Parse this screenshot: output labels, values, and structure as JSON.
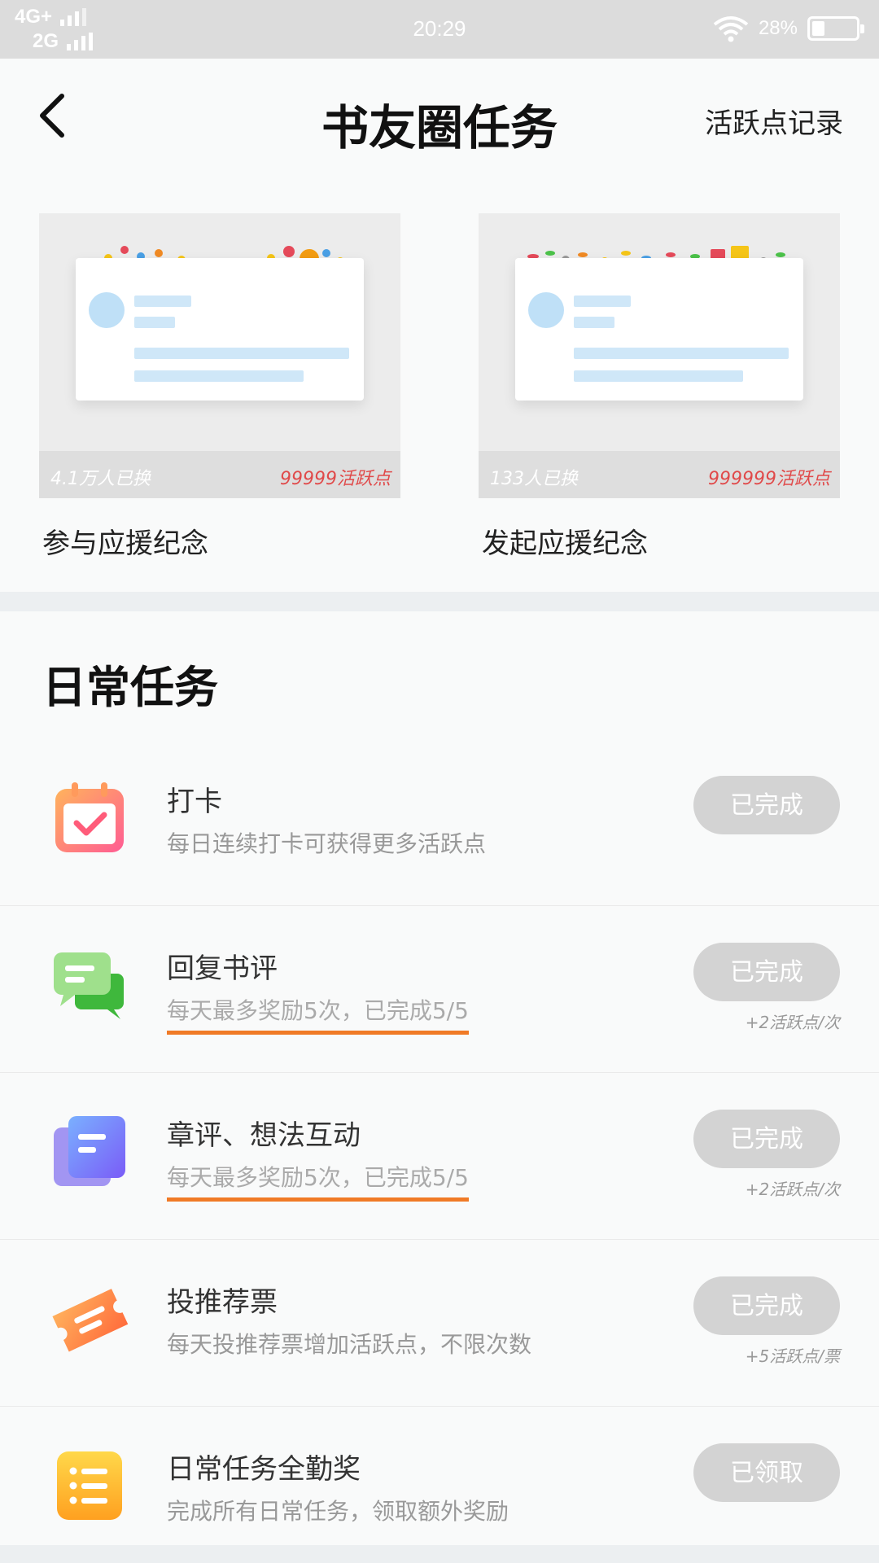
{
  "status_bar": {
    "network_top": "4G+",
    "network_bottom": "2G",
    "time": "20:29",
    "battery": "28%",
    "battery_level": 0.28
  },
  "header": {
    "title": "书友圈任务",
    "record_link": "活跃点记录"
  },
  "cards": [
    {
      "preview_people": "4.1万人已换",
      "preview_points": "99999活跃点",
      "name": "参与应援纪念"
    },
    {
      "preview_people": "133人已换",
      "preview_points": "999999活跃点",
      "name": "发起应援纪念"
    }
  ],
  "daily": {
    "title": "日常任务",
    "tasks": [
      {
        "name": "打卡",
        "desc": "每日连续打卡可获得更多活跃点",
        "button": "已完成",
        "reward": "",
        "icon": "calendar-check-icon",
        "color": "#ff6b8a"
      },
      {
        "name": "回复书评",
        "desc": "每天最多奖励5次，已完成5/5",
        "button": "已完成",
        "reward": "+2活跃点/次",
        "icon": "chat-bubbles-icon",
        "color": "#4cc24a"
      },
      {
        "name": "章评、想法互动",
        "desc": "每天最多奖励5次，已完成5/5",
        "button": "已完成",
        "reward": "+2活跃点/次",
        "icon": "document-stack-icon",
        "color": "#6b6ff7"
      },
      {
        "name": "投推荐票",
        "desc": "每天投推荐票增加活跃点，不限次数",
        "button": "已完成",
        "reward": "+5活跃点/票",
        "icon": "ticket-icon",
        "color": "#ff8a3c"
      },
      {
        "name": "日常任务全勤奖",
        "desc": "完成所有日常任务，领取额外奖励",
        "button": "已领取",
        "reward": "",
        "icon": "list-icon",
        "color": "#ffb020"
      }
    ]
  }
}
